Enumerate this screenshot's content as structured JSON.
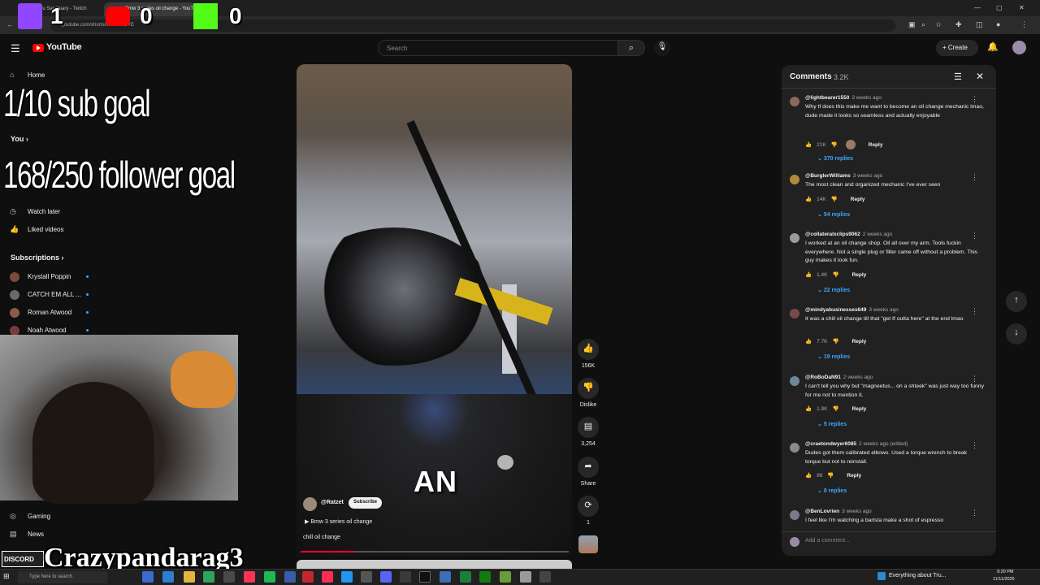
{
  "browser": {
    "tabs": [
      {
        "label": "vou Sanctuary - Twitch"
      },
      {
        "label": "Bmw 3 series oil change - YouTube"
      }
    ],
    "url": "youtube.com/shorts/mUXIfiwGYE"
  },
  "header": {
    "logo_text": "YouTube",
    "search_placeholder": "Search",
    "create_label": "Create"
  },
  "sidebar": {
    "home": "Home",
    "you_heading": "You",
    "watch_later": "Watch later",
    "liked_videos": "Liked videos",
    "subscriptions_heading": "Subscriptions",
    "subscriptions": [
      {
        "name": "Krystall Poppin",
        "color": "#7a4a3a"
      },
      {
        "name": "CATCH EM ALL ...",
        "color": "#6a6a6a"
      },
      {
        "name": "Roman Atwood",
        "color": "#8a5a4a"
      },
      {
        "name": "Noah Atwood",
        "color": "#7a3a3a"
      }
    ],
    "gaming": "Gaming",
    "news": "News"
  },
  "overlay": {
    "sub_goal": "1/10 sub goal",
    "follower_goal": "168/250 follower goal",
    "streamer_name": "Crazypandarag3",
    "discord_label": "DISCORD",
    "scores": [
      {
        "platform": "twitch",
        "value": "1",
        "color": "#9146ff"
      },
      {
        "platform": "youtube",
        "value": "0",
        "color": "#ff0000"
      },
      {
        "platform": "kick",
        "value": "0",
        "color": "#53fc18"
      }
    ]
  },
  "short": {
    "caption_overlay": "AN",
    "channel": "@Ratzet",
    "subscribe_label": "Subscribe",
    "playlist": "Bmw 3 series oil change",
    "title": "chill oil change",
    "progress": 0.2,
    "likes": "156K",
    "dislike_label": "Dislike",
    "comments_count": "3,254",
    "share_label": "Share",
    "remix_count": "1"
  },
  "comments": {
    "title": "Comments",
    "count": "3.2K",
    "add_placeholder": "Add a comment...",
    "items": [
      {
        "user": "@lightbearer1550",
        "time": "3 weeks ago",
        "text": "Why tf does this make me want to become an oil change mechanic lmao, dude made it looks so seamless and actually enjoyable",
        "likes": "21K",
        "replies": "370 replies",
        "reply_label": "Reply",
        "avatar": "#8a6a5a",
        "heart": true
      },
      {
        "user": "@BurglerWilliams",
        "time": "3 weeks ago",
        "text": "The most clean and organized mechanic I've ever seen",
        "likes": "14K",
        "replies": "54 replies",
        "reply_label": "Reply",
        "avatar": "#b08a3a",
        "heart": false
      },
      {
        "user": "@collateralxclips9062",
        "time": "2 weeks ago",
        "text": "I worked at an oil change shop. Oil all over my arm. Tools fuckin everywhere. Not a single plug or filter came off without a problem. This guy makes it look fun.",
        "likes": "1.4K",
        "replies": "22 replies",
        "reply_label": "Reply",
        "avatar": "#9a9a9a",
        "heart": false
      },
      {
        "user": "@mindyabusinesses649",
        "time": "3 weeks ago",
        "text": "It was a chill oil change till that \"get tf outta here\" at the end lmao",
        "likes": "7.7K",
        "replies": "19 replies",
        "reply_label": "Reply",
        "avatar": "#7a4a4a",
        "heart": false
      },
      {
        "user": "@RoBoDaN91",
        "time": "2 weeks ago",
        "text": "I can't tell you why but \"magneetus... on a shteek\" was just way too funny for me not to mention it.",
        "likes": "1.9K",
        "replies": "5 replies",
        "reply_label": "Reply",
        "avatar": "#6a8a9a",
        "heart": false
      },
      {
        "user": "@craetondwyer6085",
        "time": "2 weeks ago (edited)",
        "text": "Dudes got them calibrated elbows. Used a torque wrench to break torque but not to reinstall.",
        "likes": "98",
        "replies": "8 replies",
        "reply_label": "Reply",
        "avatar": "#8a8a8a",
        "heart": false
      },
      {
        "user": "@BenLovrien",
        "time": "3 weeks ago",
        "text": "I feel like I'm watching a barista make a shot of espresso",
        "likes": "",
        "replies": "",
        "reply_label": "",
        "avatar": "#7a7a8a",
        "heart": false
      }
    ]
  },
  "taskbar": {
    "search_placeholder": "Type here to search",
    "news": "Everything about Tru...",
    "time": "9:20 PM",
    "date": "11/11/2025"
  }
}
